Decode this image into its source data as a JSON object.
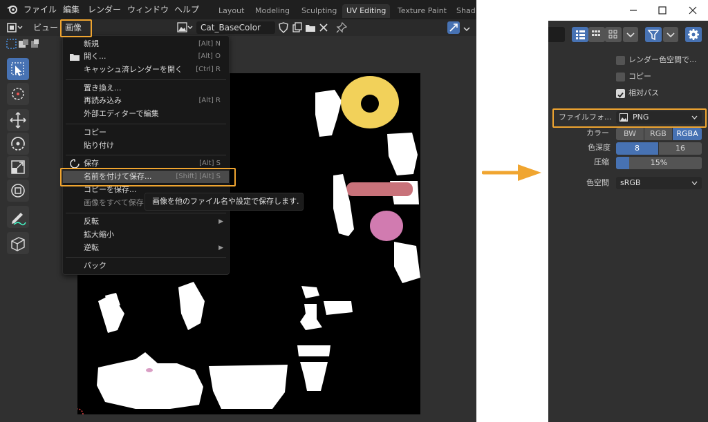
{
  "topbar": {
    "menus": [
      "ファイル",
      "編集",
      "レンダー",
      "ウィンドウ",
      "ヘルプ"
    ],
    "workspaces": [
      "Layout",
      "Modeling",
      "Sculpting",
      "UV Editing",
      "Texture Paint",
      "Shad"
    ],
    "active_workspace": "UV Editing"
  },
  "header": {
    "view_label": "ビュー",
    "image_label": "画像",
    "image_name": "Cat_BaseColor"
  },
  "menu": {
    "items": [
      {
        "label": "新規",
        "shortcut": "[Alt] N"
      },
      {
        "label": "開く...",
        "shortcut": "[Alt] O"
      },
      {
        "label": "キャッシュ済レンダーを開く",
        "shortcut": "[Ctrl] R"
      },
      {
        "label": "置き換え..."
      },
      {
        "label": "再読み込み",
        "shortcut": "[Alt] R"
      },
      {
        "label": "外部エディターで編集"
      },
      {
        "label": "コピー"
      },
      {
        "label": "貼り付け"
      },
      {
        "label": "保存",
        "shortcut": "[Alt] S"
      },
      {
        "label": "名前を付けて保存...",
        "shortcut": "[Shift] [Alt] S"
      },
      {
        "label": "コピーを保存..."
      },
      {
        "label": "画像をすべて保存"
      },
      {
        "label": "反転"
      },
      {
        "label": "拡大縮小"
      },
      {
        "label": "逆転"
      },
      {
        "label": "パック"
      }
    ],
    "tooltip": "画像を他のファイル名や設定で保存します."
  },
  "right_panel": {
    "checkboxes": [
      {
        "label": "レンダー色空間で...",
        "checked": false
      },
      {
        "label": "コピー",
        "checked": false
      },
      {
        "label": "相対パス",
        "checked": true
      }
    ],
    "file_format_label": "ファイルフォ...",
    "file_format_value": "PNG",
    "color_label": "カラー",
    "color_options": [
      "BW",
      "RGB",
      "RGBA"
    ],
    "color_selected": "RGBA",
    "depth_label": "色深度",
    "depth_options": [
      "8",
      "16"
    ],
    "depth_selected": "8",
    "compression_label": "圧縮",
    "compression_value": "15%",
    "compression_fraction": 0.15,
    "colorspace_label": "色空間",
    "colorspace_value": "sRGB"
  },
  "colors": {
    "accent": "#4772b3",
    "highlight": "#f0a530"
  }
}
